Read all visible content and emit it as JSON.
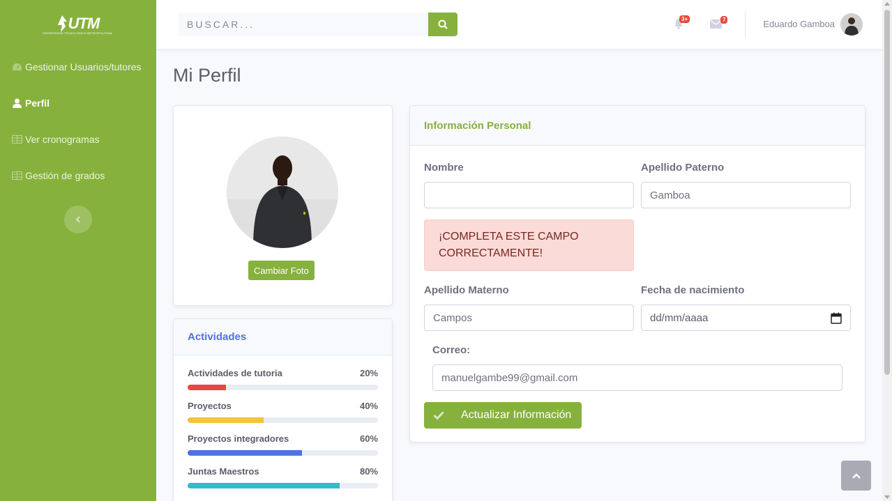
{
  "brand": {
    "name": "UTM",
    "subtitle": "UNIVERSIDAD TECNOLÓGICA METROPOLITANA"
  },
  "sidebar": {
    "items": [
      {
        "label": "Gestionar Usuarios/tutores",
        "icon": "tachometer-icon"
      },
      {
        "label": "Perfil",
        "icon": "user-icon",
        "active": true
      },
      {
        "label": "Ver cronogramas",
        "icon": "table-icon"
      },
      {
        "label": "Gestión de grados",
        "icon": "table-icon"
      }
    ]
  },
  "topbar": {
    "search_placeholder": "BUSCAR...",
    "alerts_badge": "3+",
    "messages_badge": "7",
    "user_name": "Eduardo Gamboa"
  },
  "page": {
    "title": "Mi Perfil"
  },
  "profile": {
    "change_photo_label": "Cambiar Foto"
  },
  "activities": {
    "title": "Actividades",
    "items": [
      {
        "label": "Actividades de tutoria",
        "percent_label": "20%",
        "value": 20,
        "color": "#e74a3b"
      },
      {
        "label": "Proyectos",
        "percent_label": "40%",
        "value": 40,
        "color": "#f6c23e"
      },
      {
        "label": "Proyectos integradores",
        "percent_label": "60%",
        "value": 60,
        "color": "#4e73df"
      },
      {
        "label": "Juntas Maestros",
        "percent_label": "80%",
        "value": 80,
        "color": "#36b9cc"
      }
    ]
  },
  "personal_info": {
    "title": "Información Personal",
    "nombre_label": "Nombre",
    "nombre_value": "",
    "apellido_paterno_label": "Apellido Paterno",
    "apellido_paterno_value": "Gamboa",
    "alert_text": "¡COMPLETA ESTE CAMPO CORRECTAMENTE!",
    "apellido_materno_label": "Apellido Materno",
    "apellido_materno_value": "Campos",
    "fecha_label": "Fecha de nacimiento",
    "fecha_placeholder": "dd/mm/aaaa",
    "correo_label": "Correo:",
    "correo_value": "manuelgambe99@gmail.com",
    "update_button": "Actualizar Información"
  },
  "colors": {
    "brand": "#86b13d",
    "primary": "#4e73df",
    "danger": "#e74a3b"
  }
}
